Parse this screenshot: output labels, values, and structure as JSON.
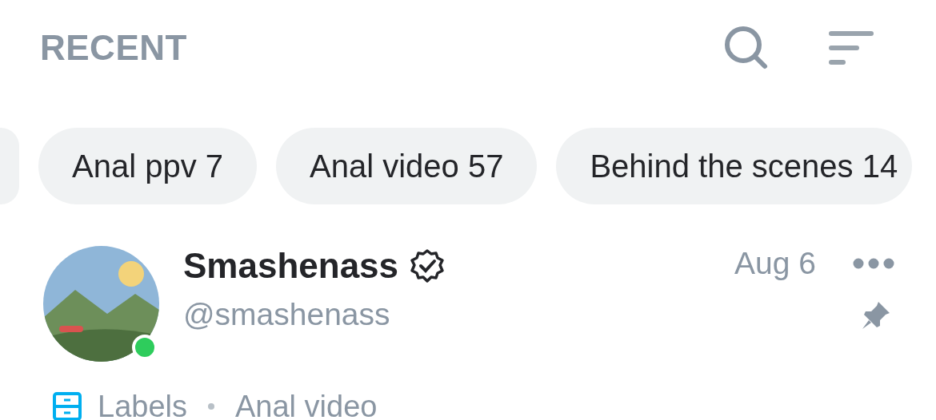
{
  "header": {
    "title": "RECENT"
  },
  "chips": [
    {
      "label": "Anal ppv 7",
      "selected": false
    },
    {
      "label": "Anal video 57",
      "selected": false
    },
    {
      "label": "Behind the scenes 14",
      "selected": false
    }
  ],
  "post": {
    "avatar": {
      "kind": "picture",
      "online": true
    },
    "name": "Smashenass",
    "verified": true,
    "handle": "@smashenass",
    "date": "Aug 6",
    "pinned": true
  },
  "labels": {
    "title": "Labels",
    "items": [
      "Anal video"
    ]
  }
}
